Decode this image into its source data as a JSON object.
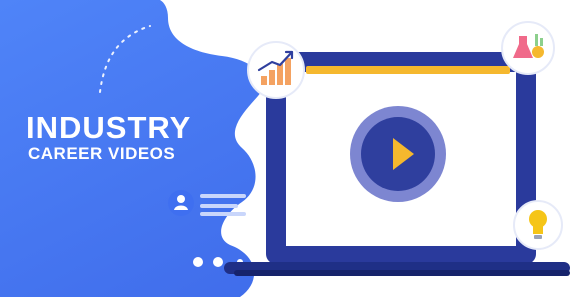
{
  "hero": {
    "title": "INDUSTRY",
    "subtitle": "CAREER VIDEOS"
  },
  "icons": [
    "growth-chart-icon",
    "chemistry-flask-icon",
    "lightbulb-icon",
    "user-profile-icon",
    "play-icon"
  ],
  "colors": {
    "background_blue": "#3f6ff0",
    "laptop_frame": "#2a3a9c",
    "laptop_base": "#1f2f86",
    "screen_bar": "#f5b82e",
    "play_ring": "#7d86d1",
    "play_core": "#2f3f9e",
    "play_triangle": "#f5b82e",
    "cloud": "#ffffff"
  }
}
